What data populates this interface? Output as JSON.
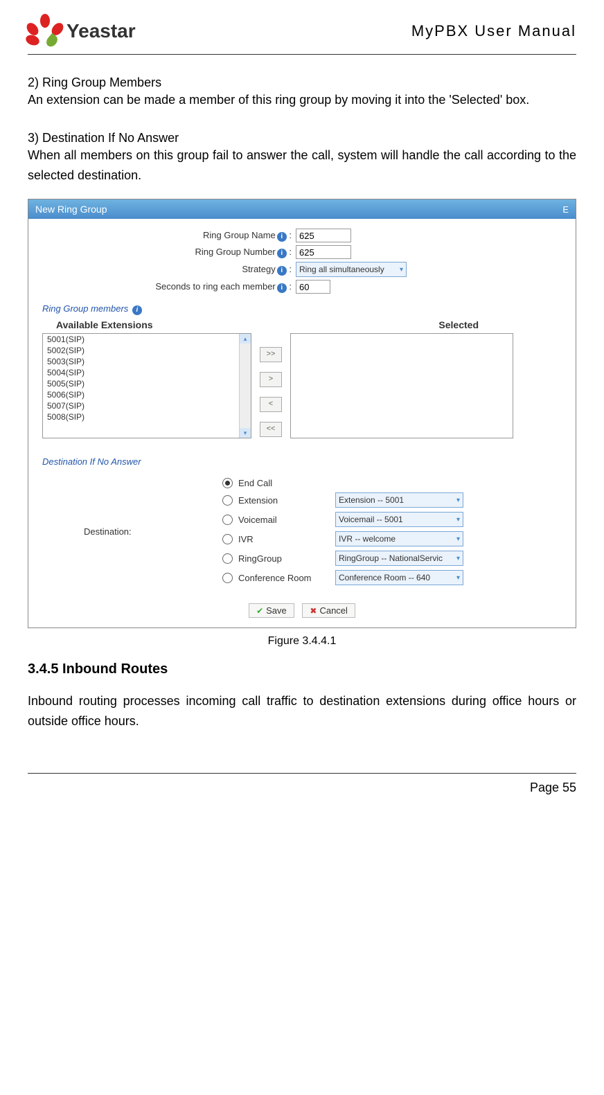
{
  "header": {
    "logo_text": "Yeastar",
    "doc_title": "MyPBX User Manual"
  },
  "section2": {
    "title": "2) Ring Group Members",
    "text": "An extension can be made a member of this ring group by moving it into the 'Selected' box."
  },
  "section3": {
    "title": "3) Destination If No Answer",
    "text": "When all members on this group fail to answer the call, system will handle the call according to the selected destination."
  },
  "figure": {
    "window_title": "New Ring Group",
    "labels": {
      "ring_group_name": "Ring Group Name",
      "ring_group_number": "Ring Group Number",
      "strategy": "Strategy",
      "seconds": "Seconds to ring each member"
    },
    "values": {
      "ring_group_name": "625",
      "ring_group_number": "625",
      "strategy": "Ring all simultaneously",
      "seconds": "60"
    },
    "members_section": "Ring Group members",
    "available_title": "Available Extensions",
    "selected_title": "Selected",
    "available_extensions": [
      "5001(SIP)",
      "5002(SIP)",
      "5003(SIP)",
      "5004(SIP)",
      "5005(SIP)",
      "5006(SIP)",
      "5007(SIP)",
      "5008(SIP)"
    ],
    "move_buttons": [
      ">>",
      ">",
      "<",
      "<<"
    ],
    "dest_section": "Destination If No Answer",
    "dest_label": "Destination:",
    "dest_options": [
      {
        "label": "End Call",
        "checked": true,
        "select": null
      },
      {
        "label": "Extension",
        "checked": false,
        "select": "Extension -- 5001"
      },
      {
        "label": "Voicemail",
        "checked": false,
        "select": "Voicemail -- 5001"
      },
      {
        "label": "IVR",
        "checked": false,
        "select": "IVR -- welcome"
      },
      {
        "label": "RingGroup",
        "checked": false,
        "select": "RingGroup -- NationalServic"
      },
      {
        "label": "Conference Room",
        "checked": false,
        "select": "Conference Room -- 640"
      }
    ],
    "save_label": "Save",
    "cancel_label": "Cancel",
    "caption": "Figure 3.4.4.1"
  },
  "section345": {
    "heading": "3.4.5 Inbound Routes",
    "text": "Inbound routing processes incoming call traffic to destination extensions during office hours or outside office hours."
  },
  "footer": {
    "page": "Page 55"
  }
}
